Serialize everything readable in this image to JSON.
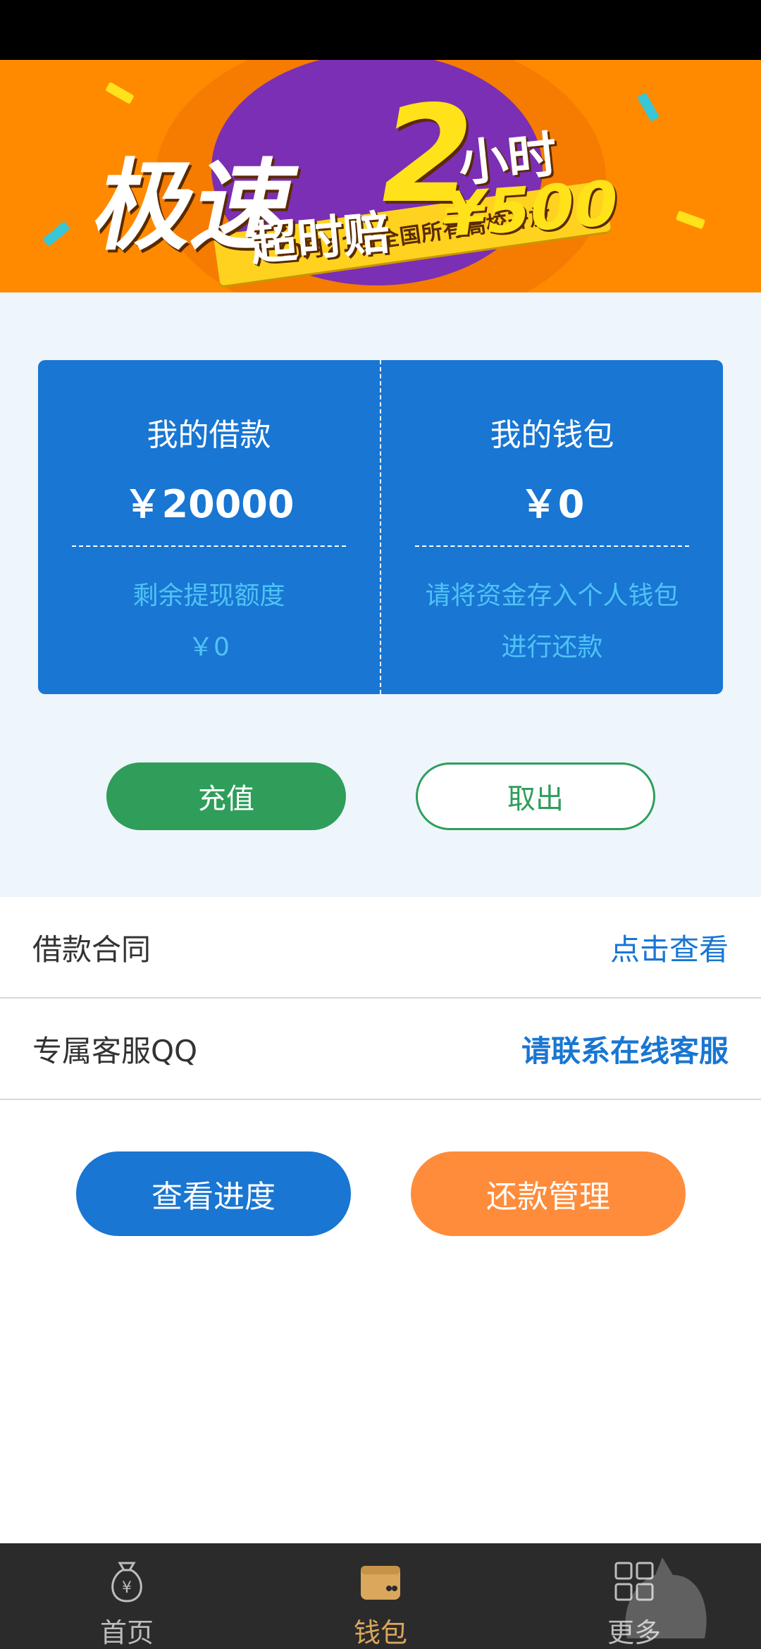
{
  "banner": {
    "headline": "极速",
    "big_number": "2",
    "hours_text": "小时",
    "payout_text": "超时赔",
    "payout_amount": "¥500",
    "ribbon_text": "10月21日全国所有高校开放"
  },
  "summary": {
    "loan": {
      "title": "我的借款",
      "amount": "￥20000",
      "sub_label": "剩余提现额度",
      "sub_value": "￥0"
    },
    "wallet": {
      "title": "我的钱包",
      "amount": "￥0",
      "note_line1": "请将资金存入个人钱包",
      "note_line2": "进行还款"
    },
    "recharge_label": "充值",
    "withdraw_label": "取出"
  },
  "rows": {
    "contract": {
      "label": "借款合同",
      "link": "点击查看"
    },
    "service": {
      "label": "专属客服QQ",
      "link": "请联系在线客服"
    }
  },
  "actions": {
    "progress_label": "查看进度",
    "repay_label": "还款管理"
  },
  "nav": {
    "items": [
      {
        "label": "首页",
        "icon": "money-bag-icon",
        "active": false
      },
      {
        "label": "钱包",
        "icon": "wallet-icon",
        "active": true
      },
      {
        "label": "更多",
        "icon": "grid-icon",
        "active": false
      }
    ]
  },
  "colors": {
    "primary_blue": "#1976d2",
    "green": "#2e9e5a",
    "orange": "#ff8c3a",
    "nav_active": "#d9a85c"
  }
}
